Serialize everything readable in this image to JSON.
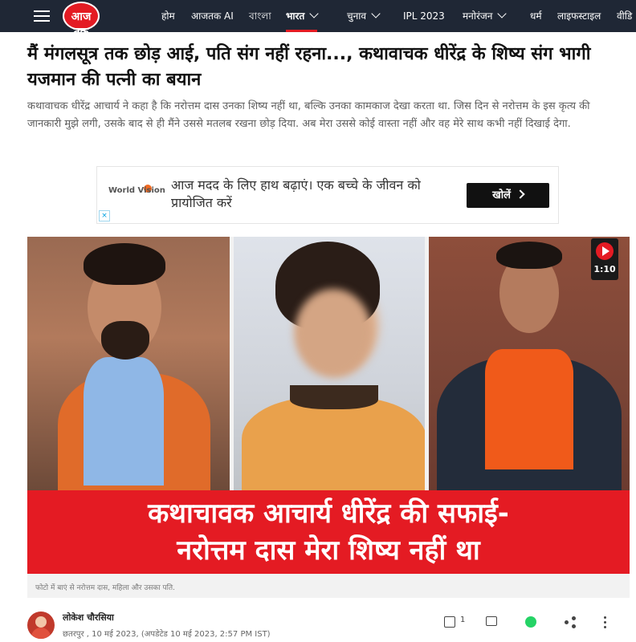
{
  "nav": {
    "logo_text": "आज तक",
    "items": [
      {
        "label": "होम"
      },
      {
        "label": "आजतक AI"
      },
      {
        "label": "বাংলা"
      },
      {
        "label": "भारत"
      },
      {
        "label": "चुनाव"
      },
      {
        "label": "IPL 2023"
      },
      {
        "label": "मनोरंजन"
      },
      {
        "label": "धर्म"
      },
      {
        "label": "लाइफस्टाइल"
      },
      {
        "label": "वीडि"
      }
    ],
    "active_color": "#e41b23",
    "bg_color": "#1f2735"
  },
  "article": {
    "headline": "मैं मंगलसूत्र तक छोड़ आई, पति संग नहीं रहना..., कथावाचक धीरेंद्र के शिष्य संग भागी यजमान की पत्नी का बयान",
    "summary": "कथावाचक धीरेंद्र आचार्य ने कहा है कि नरोत्तम दास उनका शिष्य नहीं था, बल्कि उनका कामकाज देखा करता था. जिस दिन से नरोत्तम के इस कृत्य की जानकारी मुझे लगी, उसके बाद से ही मैंने उससे मतलब रखना छोड़ दिया. अब मेरा उससे कोई वास्ता नहीं और वह मेरे साथ कभी नहीं दिखाई देगा."
  },
  "ad": {
    "brand": "World Vision",
    "text": "आज मदद के लिए हाथ बढ़ाएं। एक बच्चे के जीवन को प्रायोजित करें",
    "button": "खोलें"
  },
  "hero": {
    "overlay_line1": "कथाचावक आचार्य धीरेंद्र की सफाई-",
    "overlay_line2": "नरोत्तम दास मेरा शिष्य नहीं था",
    "video_duration": "1:10",
    "caption": "फोटो में बाएं से नरोत्तम दास, महिला और उसका पति."
  },
  "byline": {
    "author": "लोकेश चौरसिया",
    "dateline": "छतरपुर , 10 मई 2023, (अपडेटेड 10 मई 2023, 2:57 PM IST)",
    "like_count": "1"
  },
  "icons": [
    "menu-icon",
    "chevron-down-icon",
    "play-icon",
    "like-icon",
    "comment-icon",
    "whatsapp-icon",
    "share-icon",
    "more-icon"
  ]
}
